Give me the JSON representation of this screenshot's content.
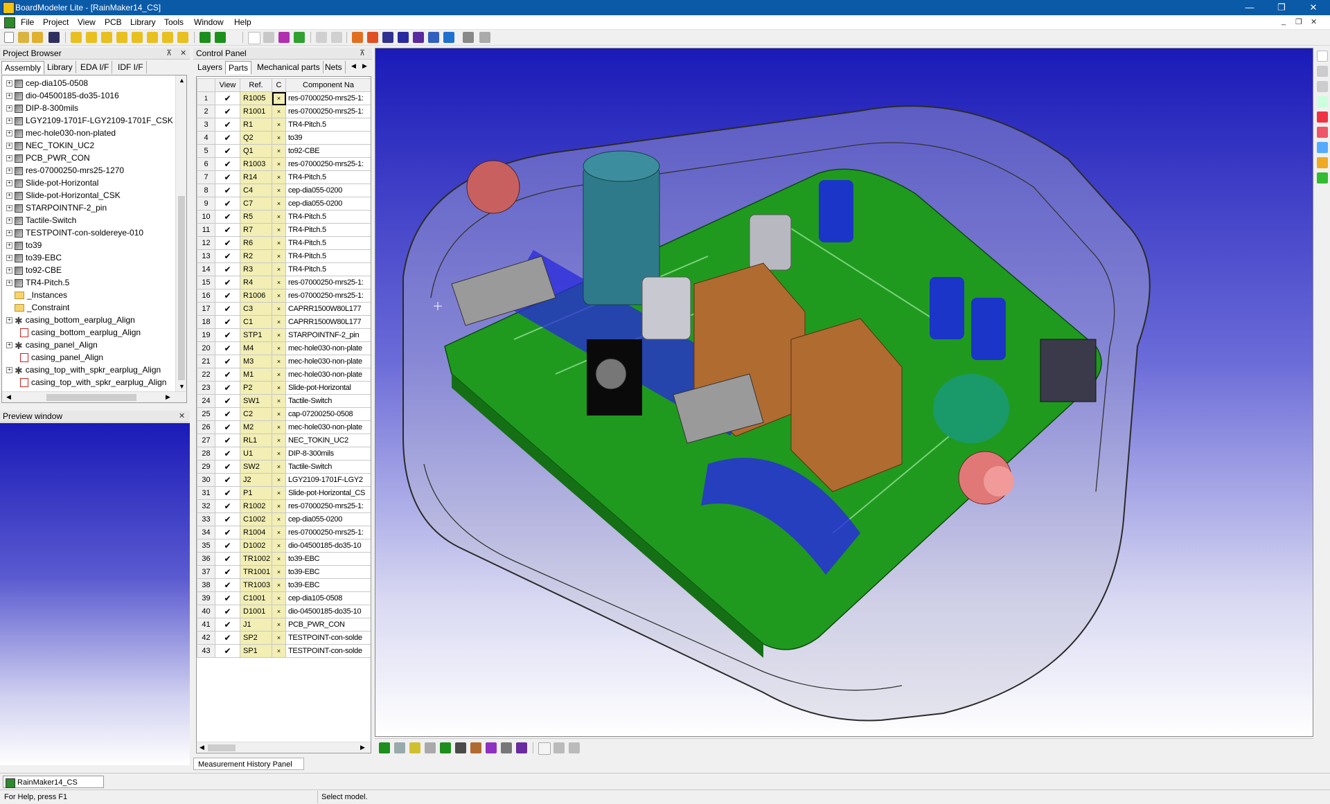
{
  "window": {
    "title": "BoardModeler Lite - [RainMaker14_CS]"
  },
  "menu": [
    "File",
    "Project",
    "View",
    "PCB",
    "Library",
    "Tools",
    "Window",
    "Help"
  ],
  "project_browser": {
    "header": "Project Browser",
    "tabs": [
      "Assembly",
      "Library",
      "EDA I/F",
      "IDF I/F"
    ],
    "tree": [
      {
        "label": "cep-dia105-0508",
        "kind": "part",
        "level": 0
      },
      {
        "label": "dio-04500185-do35-1016",
        "kind": "part",
        "level": 0
      },
      {
        "label": "DIP-8-300mils",
        "kind": "part",
        "level": 0
      },
      {
        "label": "LGY2109-1701F-LGY2109-1701F_CSK",
        "kind": "part",
        "level": 0
      },
      {
        "label": "mec-hole030-non-plated",
        "kind": "part",
        "level": 0
      },
      {
        "label": "NEC_TOKIN_UC2",
        "kind": "part",
        "level": 0
      },
      {
        "label": "PCB_PWR_CON",
        "kind": "part",
        "level": 0
      },
      {
        "label": "res-07000250-mrs25-1270",
        "kind": "part",
        "level": 0
      },
      {
        "label": "Slide-pot-Horizontal",
        "kind": "part",
        "level": 0
      },
      {
        "label": "Slide-pot-Horizontal_CSK",
        "kind": "part",
        "level": 0
      },
      {
        "label": "STARPOINTNF-2_pin",
        "kind": "part",
        "level": 0
      },
      {
        "label": "Tactile-Switch",
        "kind": "part",
        "level": 0
      },
      {
        "label": "TESTPOINT-con-soldereye-010",
        "kind": "part",
        "level": 0
      },
      {
        "label": "to39",
        "kind": "part",
        "level": 0
      },
      {
        "label": "to39-EBC",
        "kind": "part",
        "level": 0
      },
      {
        "label": "to92-CBE",
        "kind": "part",
        "level": 0
      },
      {
        "label": "TR4-Pitch.5",
        "kind": "part",
        "level": 0
      },
      {
        "label": "_Instances",
        "kind": "folder",
        "level": 0
      },
      {
        "label": "_Constraint",
        "kind": "folder",
        "level": 0
      },
      {
        "label": "casing_bottom_earplug_Align",
        "kind": "gear",
        "level": 0
      },
      {
        "label": "casing_bottom_earplug_Align",
        "kind": "asm",
        "level": 1
      },
      {
        "label": "casing_panel_Align",
        "kind": "gear",
        "level": 0
      },
      {
        "label": "casing_panel_Align",
        "kind": "asm",
        "level": 1
      },
      {
        "label": "casing_top_with_spkr_earplug_Align",
        "kind": "gear",
        "level": 0
      },
      {
        "label": "casing_top_with_spkr_earplug_Align",
        "kind": "asm",
        "level": 1
      }
    ]
  },
  "preview": {
    "header": "Preview window"
  },
  "control_panel": {
    "header": "Control Panel",
    "tabs": [
      "Layers",
      "Parts",
      "Mechanical parts",
      "Nets"
    ],
    "columns": [
      "View",
      "Ref.",
      "C",
      "Component Na"
    ],
    "rows": [
      {
        "n": "1",
        "ref": "R1005",
        "comp": "res-07000250-mrs25-1:"
      },
      {
        "n": "2",
        "ref": "R1001",
        "comp": "res-07000250-mrs25-1:"
      },
      {
        "n": "3",
        "ref": "R1",
        "comp": "TR4-Pitch.5"
      },
      {
        "n": "4",
        "ref": "Q2",
        "comp": "to39"
      },
      {
        "n": "5",
        "ref": "Q1",
        "comp": "to92-CBE"
      },
      {
        "n": "6",
        "ref": "R1003",
        "comp": "res-07000250-mrs25-1:"
      },
      {
        "n": "7",
        "ref": "R14",
        "comp": "TR4-Pitch.5"
      },
      {
        "n": "8",
        "ref": "C4",
        "comp": "cep-dia055-0200"
      },
      {
        "n": "9",
        "ref": "C7",
        "comp": "cep-dia055-0200"
      },
      {
        "n": "10",
        "ref": "R5",
        "comp": "TR4-Pitch.5"
      },
      {
        "n": "11",
        "ref": "R7",
        "comp": "TR4-Pitch.5"
      },
      {
        "n": "12",
        "ref": "R6",
        "comp": "TR4-Pitch.5"
      },
      {
        "n": "13",
        "ref": "R2",
        "comp": "TR4-Pitch.5"
      },
      {
        "n": "14",
        "ref": "R3",
        "comp": "TR4-Pitch.5"
      },
      {
        "n": "15",
        "ref": "R4",
        "comp": "res-07000250-mrs25-1:"
      },
      {
        "n": "16",
        "ref": "R1006",
        "comp": "res-07000250-mrs25-1:"
      },
      {
        "n": "17",
        "ref": "C3",
        "comp": "CAPRR1500W80L177"
      },
      {
        "n": "18",
        "ref": "C1",
        "comp": "CAPRR1500W80L177"
      },
      {
        "n": "19",
        "ref": "STP1",
        "comp": "STARPOINTNF-2_pin"
      },
      {
        "n": "20",
        "ref": "M4",
        "comp": "mec-hole030-non-plate"
      },
      {
        "n": "21",
        "ref": "M3",
        "comp": "mec-hole030-non-plate"
      },
      {
        "n": "22",
        "ref": "M1",
        "comp": "mec-hole030-non-plate"
      },
      {
        "n": "23",
        "ref": "P2",
        "comp": "Slide-pot-Horizontal"
      },
      {
        "n": "24",
        "ref": "SW1",
        "comp": "Tactile-Switch"
      },
      {
        "n": "25",
        "ref": "C2",
        "comp": "cap-07200250-0508"
      },
      {
        "n": "26",
        "ref": "M2",
        "comp": "mec-hole030-non-plate"
      },
      {
        "n": "27",
        "ref": "RL1",
        "comp": "NEC_TOKIN_UC2"
      },
      {
        "n": "28",
        "ref": "U1",
        "comp": "DIP-8-300mils"
      },
      {
        "n": "29",
        "ref": "SW2",
        "comp": "Tactile-Switch"
      },
      {
        "n": "30",
        "ref": "J2",
        "comp": "LGY2109-1701F-LGY2"
      },
      {
        "n": "31",
        "ref": "P1",
        "comp": "Slide-pot-Horizontal_CS"
      },
      {
        "n": "32",
        "ref": "R1002",
        "comp": "res-07000250-mrs25-1:"
      },
      {
        "n": "33",
        "ref": "C1002",
        "comp": "cep-dia055-0200"
      },
      {
        "n": "34",
        "ref": "R1004",
        "comp": "res-07000250-mrs25-1:"
      },
      {
        "n": "35",
        "ref": "D1002",
        "comp": "dio-04500185-do35-10"
      },
      {
        "n": "36",
        "ref": "TR1002",
        "comp": "to39-EBC"
      },
      {
        "n": "37",
        "ref": "TR1001",
        "comp": "to39-EBC"
      },
      {
        "n": "38",
        "ref": "TR1003",
        "comp": "to39-EBC"
      },
      {
        "n": "39",
        "ref": "C1001",
        "comp": "cep-dia105-0508"
      },
      {
        "n": "40",
        "ref": "D1001",
        "comp": "dio-04500185-do35-10"
      },
      {
        "n": "41",
        "ref": "J1",
        "comp": "PCB_PWR_CON"
      },
      {
        "n": "42",
        "ref": "SP2",
        "comp": "TESTPOINT-con-solde"
      },
      {
        "n": "43",
        "ref": "SP1",
        "comp": "TESTPOINT-con-solde"
      }
    ]
  },
  "bottom": {
    "measurement_tab": "Measurement History Panel",
    "doc_tab": "RainMaker14_CS"
  },
  "status": {
    "left": "For Help, press F1",
    "right": "Select model."
  },
  "colors": {
    "titlebar": "#0b5aa8",
    "viewport_top": "#1a1ab8",
    "pcb": "#1f9a1f",
    "ref_cell": "#f2eeb4"
  }
}
